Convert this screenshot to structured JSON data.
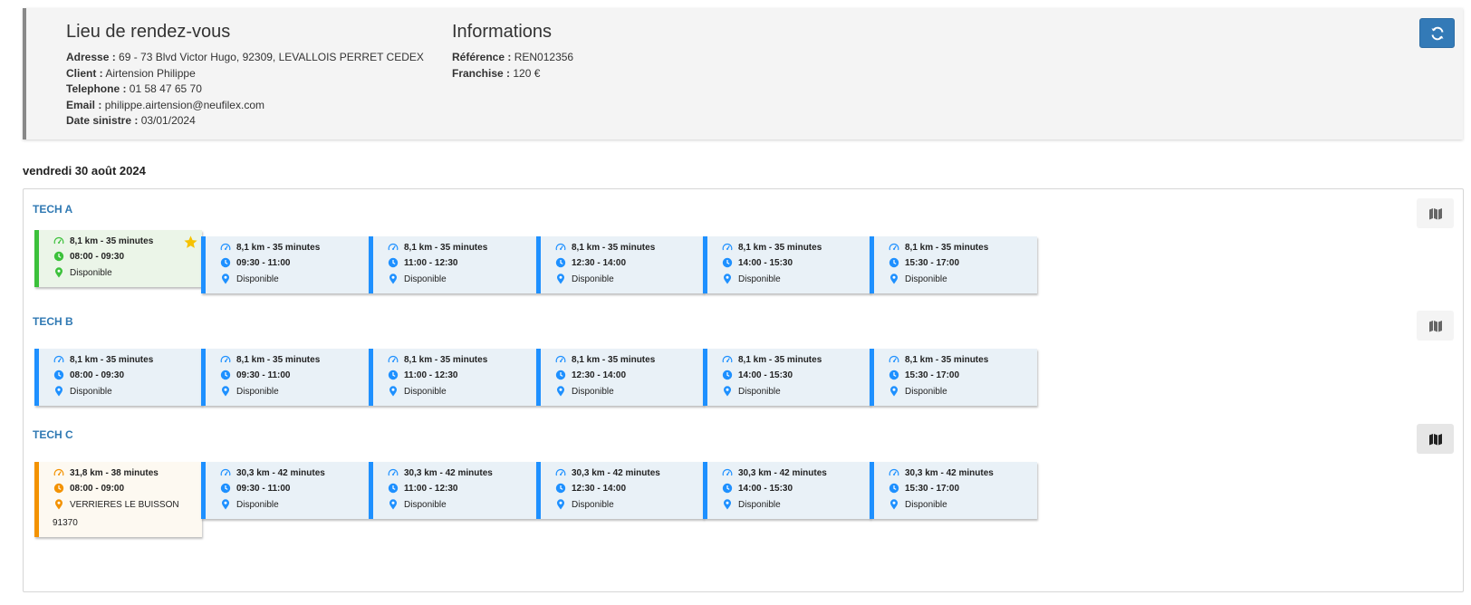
{
  "info": {
    "lieu_title": "Lieu de rendez-vous",
    "adresse_label": "Adresse :",
    "adresse_value": "69 - 73 Blvd Victor Hugo, 92309, LEVALLOIS PERRET CEDEX",
    "client_label": "Client :",
    "client_value": "Airtension Philippe",
    "telephone_label": "Telephone :",
    "telephone_value": "01 58 47 65 70",
    "email_label": "Email :",
    "email_value": "philippe.airtension@neufilex.com",
    "date_label": "Date sinistre :",
    "date_value": "03/01/2024",
    "informations_title": "Informations",
    "reference_label": "Référence :",
    "reference_value": "REN012356",
    "franchise_label": "Franchise :",
    "franchise_value": "120 €"
  },
  "refresh_icon": "refresh-icon",
  "date_heading": "vendredi 30 août 2024",
  "colors": {
    "primary": "#337ab7",
    "available": "#1e90ff",
    "recommended": "#3cc13b",
    "booked": "#f39200",
    "star": "#f6c200"
  },
  "techs": [
    {
      "name": "TECH A",
      "slots": [
        {
          "distance": "8,1 km - 35 minutes",
          "time": "08:00 - 09:30",
          "status": "Disponible",
          "variant": "green",
          "starred": true
        },
        {
          "distance": "8,1 km - 35 minutes",
          "time": "09:30 - 11:00",
          "status": "Disponible",
          "variant": "blue"
        },
        {
          "distance": "8,1 km - 35 minutes",
          "time": "11:00 - 12:30",
          "status": "Disponible",
          "variant": "blue"
        },
        {
          "distance": "8,1 km - 35 minutes",
          "time": "12:30 - 14:00",
          "status": "Disponible",
          "variant": "blue"
        },
        {
          "distance": "8,1 km - 35 minutes",
          "time": "14:00 - 15:30",
          "status": "Disponible",
          "variant": "blue"
        },
        {
          "distance": "8,1 km - 35 minutes",
          "time": "15:30 - 17:00",
          "status": "Disponible",
          "variant": "blue"
        }
      ]
    },
    {
      "name": "TECH B",
      "slots": [
        {
          "distance": "8,1 km - 35 minutes",
          "time": "08:00 - 09:30",
          "status": "Disponible",
          "variant": "blue"
        },
        {
          "distance": "8,1 km - 35 minutes",
          "time": "09:30 - 11:00",
          "status": "Disponible",
          "variant": "blue"
        },
        {
          "distance": "8,1 km - 35 minutes",
          "time": "11:00 - 12:30",
          "status": "Disponible",
          "variant": "blue"
        },
        {
          "distance": "8,1 km - 35 minutes",
          "time": "12:30 - 14:00",
          "status": "Disponible",
          "variant": "blue"
        },
        {
          "distance": "8,1 km - 35 minutes",
          "time": "14:00 - 15:30",
          "status": "Disponible",
          "variant": "blue"
        },
        {
          "distance": "8,1 km - 35 minutes",
          "time": "15:30 - 17:00",
          "status": "Disponible",
          "variant": "blue"
        }
      ]
    },
    {
      "name": "TECH C",
      "slots": [
        {
          "distance": "31,8 km - 38 minutes",
          "time": "08:00 - 09:00",
          "status": "VERRIERES LE BUISSON",
          "extra": "91370",
          "variant": "orange"
        },
        {
          "distance": "30,3 km - 42 minutes",
          "time": "09:30 - 11:00",
          "status": "Disponible",
          "variant": "blue"
        },
        {
          "distance": "30,3 km - 42 minutes",
          "time": "11:00 - 12:30",
          "status": "Disponible",
          "variant": "blue"
        },
        {
          "distance": "30,3 km - 42 minutes",
          "time": "12:30 - 14:00",
          "status": "Disponible",
          "variant": "blue"
        },
        {
          "distance": "30,3 km - 42 minutes",
          "time": "14:00 - 15:30",
          "status": "Disponible",
          "variant": "blue"
        },
        {
          "distance": "30,3 km - 42 minutes",
          "time": "15:30 - 17:00",
          "status": "Disponible",
          "variant": "blue"
        }
      ]
    }
  ]
}
